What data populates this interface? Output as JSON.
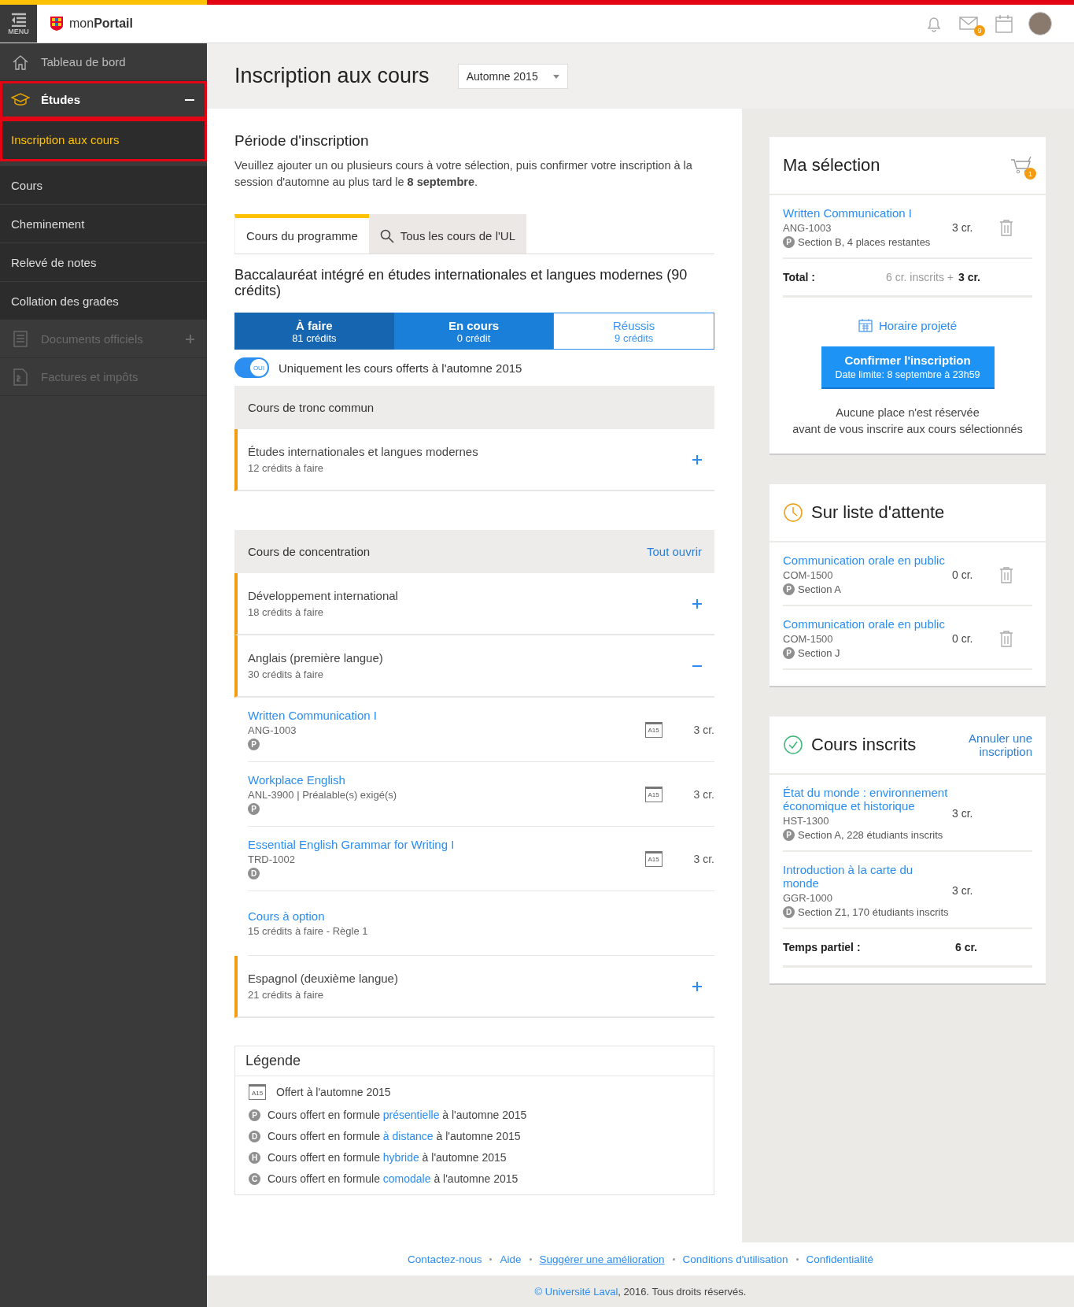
{
  "header": {
    "menu_label": "MENU",
    "logo": "mon**Portail**",
    "mail_badge": "9"
  },
  "sidebar": {
    "items": [
      {
        "label": "Tableau de bord",
        "selected": false,
        "highlighted": false,
        "disabled": false
      },
      {
        "label": "Études",
        "selected": false,
        "highlighted": true,
        "disabled": false,
        "expanded": true,
        "children": [
          {
            "label": "Inscription aux cours",
            "selected": true,
            "highlighted": true
          },
          {
            "label": "Cours",
            "selected": false,
            "highlighted": false
          },
          {
            "label": "Cheminement",
            "selected": false,
            "highlighted": false
          },
          {
            "label": "Relevé de notes",
            "selected": false,
            "highlighted": false
          },
          {
            "label": "Collation des grades",
            "selected": false,
            "highlighted": false
          }
        ]
      },
      {
        "label": "Documents officiels",
        "selected": false,
        "highlighted": false,
        "disabled": true,
        "expanded": false
      },
      {
        "label": "Factures et impôts",
        "selected": false,
        "highlighted": false,
        "disabled": true
      }
    ]
  },
  "page": {
    "title": "Inscription aux cours",
    "session": "Automne 2015"
  },
  "registration": {
    "heading": "Période d'inscription",
    "intro": "Veuillez ajouter un ou plusieurs cours à votre sélection, puis confirmer votre inscription à la session d'automne au plus tard le **8 septembre**.",
    "tabs": [
      {
        "label": "Cours du programme",
        "selected": true,
        "search": false
      },
      {
        "label": "Tous les cours de l'UL",
        "selected": false,
        "search": true
      }
    ],
    "program_title": "Baccalauréat intégré en études internationales et langues modernes (90 crédits)",
    "progress": [
      {
        "kind": "todo",
        "label": "À faire",
        "value": "81 crédits"
      },
      {
        "kind": "current",
        "label": "En cours",
        "value": "0 crédit"
      },
      {
        "kind": "done",
        "label": "Réussis",
        "value": "9 crédits"
      }
    ],
    "filter": {
      "on": true,
      "toggle_label": "OUI",
      "label": "Uniquement les cours offerts à l'automne 2015"
    },
    "sections": [
      {
        "title": "Cours de tronc commun",
        "items": [
          {
            "kind": "group",
            "name": "Études internationales et langues modernes",
            "sub": "12 crédits à faire",
            "expanded": false
          }
        ]
      },
      {
        "title": "Cours de concentration",
        "action": "Tout ouvrir",
        "items": [
          {
            "kind": "group",
            "name": "Développement international",
            "sub": "18 crédits à faire",
            "expanded": false
          },
          {
            "kind": "group",
            "name": "Anglais (première langue)",
            "sub": "30 crédits à faire",
            "expanded": true,
            "children": [
              {
                "kind": "course",
                "name": "Written Communication I",
                "code": "ANG-1003",
                "mode": "P",
                "offered": "A15",
                "credits": "3 cr."
              },
              {
                "kind": "course",
                "name": "Workplace English",
                "code": "ANL-3900 | Préalable(s) exigé(s)",
                "mode": "P",
                "offered": "A15",
                "credits": "3 cr."
              },
              {
                "kind": "course",
                "name": "Essential English Grammar for Writing I",
                "code": "TRD-1002",
                "mode": "D",
                "offered": "A15",
                "credits": "3 cr."
              },
              {
                "kind": "option",
                "name": "Cours à option",
                "sub": "15 crédits à faire - Règle 1"
              }
            ]
          },
          {
            "kind": "group",
            "name": "Espagnol (deuxième langue)",
            "sub": "21 crédits à faire",
            "expanded": false
          }
        ]
      }
    ],
    "legend": {
      "title": "Légende",
      "items": [
        {
          "kind": "offered",
          "icon_label": "A15",
          "text": "Offert à l'automne 2015"
        },
        {
          "kind": "mode",
          "mode": "P",
          "before": "Cours offert en formule",
          "link": "présentielle",
          "after": "à l'automne 2015"
        },
        {
          "kind": "mode",
          "mode": "D",
          "before": "Cours offert en formule",
          "link": "à distance",
          "after": "à l'automne 2015"
        },
        {
          "kind": "mode",
          "mode": "H",
          "before": "Cours offert en formule",
          "link": "hybride",
          "after": "à l'automne 2015"
        },
        {
          "kind": "mode",
          "mode": "C",
          "before": "Cours offert en formule",
          "link": "comodale",
          "after": "à l'automne 2015"
        }
      ]
    }
  },
  "selection": {
    "title": "Ma sélection",
    "cart_badge": "1",
    "items": [
      {
        "name": "Written Communication I",
        "code": "ANG-1003",
        "mode": "P",
        "section": "Section B, 4 places restantes",
        "credits": "3 cr."
      }
    ],
    "total_label": "Total :",
    "total_enrolled": "6 cr. inscrits +",
    "total_value": "3 cr.",
    "schedule_link": "Horaire projeté",
    "confirm": {
      "label": "Confirmer l'inscription",
      "sub": "Date limite: 8 septembre à 23h59"
    },
    "note_lines": [
      "Aucune place n'est réservée",
      "avant de vous inscrire aux cours sélectionnés"
    ]
  },
  "waitlist": {
    "title": "Sur liste d'attente",
    "items": [
      {
        "name": "Communication orale en public",
        "code": "COM-1500",
        "mode": "P",
        "section": "Section A",
        "credits": "0 cr."
      },
      {
        "name": "Communication orale en public",
        "code": "COM-1500",
        "mode": "P",
        "section": "Section J",
        "credits": "0 cr."
      }
    ]
  },
  "enrolled": {
    "title": "Cours inscrits",
    "action": "Annuler une inscription",
    "items": [
      {
        "name": "État du monde : environnement économique et historique",
        "code": "HST-1300",
        "mode": "P",
        "section": "Section A, 228 étudiants inscrits",
        "credits": "3 cr."
      },
      {
        "name": "Introduction à la carte du monde",
        "code": "GGR-1000",
        "mode": "D",
        "section": "Section Z1, 170 étudiants inscrits",
        "credits": "3 cr."
      }
    ],
    "total_label": "Temps partiel :",
    "total_value": "6 cr."
  },
  "footer": {
    "links": [
      {
        "label": "Contactez-nous",
        "underlined": false
      },
      {
        "label": "Aide",
        "underlined": false
      },
      {
        "label": "Suggérer une amélioration",
        "underlined": true
      },
      {
        "label": "Conditions d'utilisation",
        "underlined": false
      },
      {
        "label": "Confidentialité",
        "underlined": false
      }
    ],
    "copyright_link": "© Université Laval",
    "copyright_rest": ", 2016. Tous droits réservés."
  }
}
